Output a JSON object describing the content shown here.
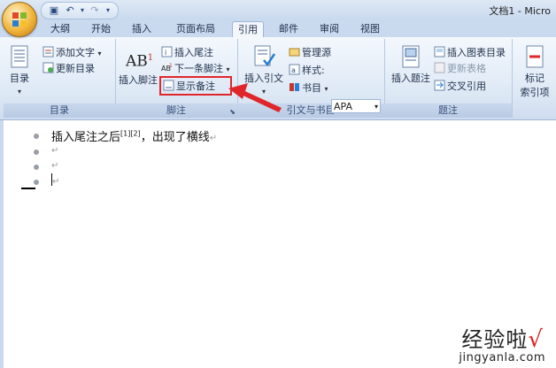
{
  "title_bar": {
    "document_title": "文档1 - Micro"
  },
  "tabs": [
    "大纲",
    "开始",
    "插入",
    "页面布局",
    "引用",
    "邮件",
    "审阅",
    "视图"
  ],
  "active_tab": "引用",
  "ribbon": {
    "toc": {
      "big_label": "目录",
      "items": [
        "添加文字",
        "更新目录"
      ],
      "group_label": "目录"
    },
    "footnotes": {
      "big_label": "插入脚注",
      "items": [
        "插入尾注",
        "下一条脚注",
        "显示备注"
      ],
      "group_label": "脚注"
    },
    "citations": {
      "big_label": "插入引文",
      "items": [
        "管理源",
        "样式:",
        "书目"
      ],
      "style_value": "APA",
      "group_label": "引文与书目"
    },
    "captions": {
      "big_label": "插入题注",
      "items": [
        "插入图表目录",
        "更新表格",
        "交叉引用"
      ],
      "group_label": "题注"
    },
    "index": {
      "big_label_line1": "标记",
      "big_label_line2": "索引项"
    }
  },
  "document": {
    "line1_text": "插入尾注之后",
    "line1_marks": "[1][2]",
    "line1_rest": "，出现了横线",
    "para_mark": "↵"
  },
  "watermark": {
    "cn": "经验啦",
    "check": "√",
    "url": "jingyanla.com"
  },
  "colors": {
    "highlight": "#e0262b",
    "arrow": "#e0262b"
  }
}
